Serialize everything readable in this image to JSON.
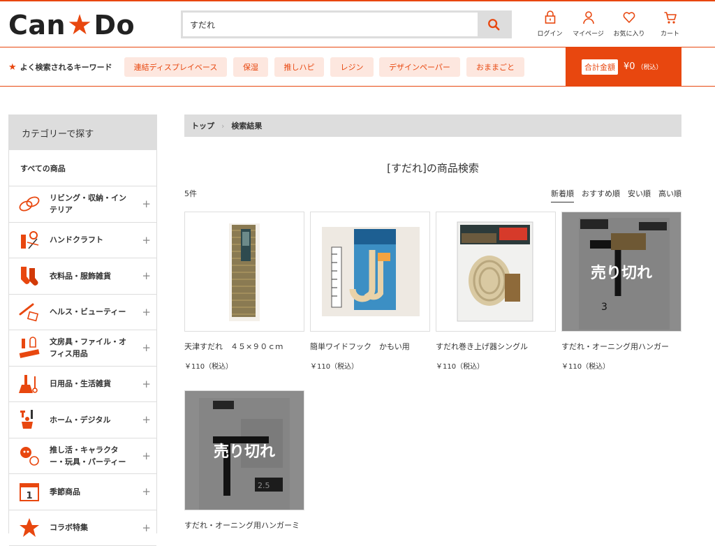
{
  "header": {
    "logo_left": "Can",
    "logo_right": "Do",
    "search_value": "すだれ",
    "icons": [
      {
        "label": "ログイン",
        "icon": "lock-icon"
      },
      {
        "label": "マイページ",
        "icon": "user-icon"
      },
      {
        "label": "お気に入り",
        "icon": "heart-icon"
      },
      {
        "label": "カート",
        "icon": "cart-icon"
      }
    ]
  },
  "keywords": {
    "title": "よく検索されるキーワード",
    "items": [
      "連結ディスプレイベース",
      "保湿",
      "推しハピ",
      "レジン",
      "デザインペーパー",
      "おままごと"
    ]
  },
  "total": {
    "label": "合計金額",
    "amount": "¥0",
    "tax": "（税込）"
  },
  "sidebar": {
    "title": "カテゴリーで探す",
    "all": "すべての商品",
    "items": [
      {
        "label": "リビング・収納・インテリア",
        "icon": "living-icon"
      },
      {
        "label": "ハンドクラフト",
        "icon": "handcraft-icon"
      },
      {
        "label": "衣料品・服飾雑貨",
        "icon": "socks-icon"
      },
      {
        "label": "ヘルス・ビューティー",
        "icon": "beauty-icon"
      },
      {
        "label": "文房具・ファイル・オフィス用品",
        "icon": "stationery-icon"
      },
      {
        "label": "日用品・生活雑貨",
        "icon": "daily-goods-icon"
      },
      {
        "label": "ホーム・デジタル",
        "icon": "tools-icon"
      },
      {
        "label": "推し活・キャラクター・玩具・パーティー",
        "icon": "party-icon"
      },
      {
        "label": "季節商品",
        "icon": "calendar-icon"
      },
      {
        "label": "コラボ特集",
        "icon": "star-icon"
      }
    ]
  },
  "breadcrumb": [
    "トップ",
    "検索結果"
  ],
  "results": {
    "title": "[すだれ]の商品検索",
    "count": "5件",
    "sorts": [
      "新着順",
      "おすすめ順",
      "安い順",
      "高い順"
    ],
    "sold_out_label": "売り切れ",
    "products": [
      {
        "name": "天津すだれ　４５×９０ｃｍ",
        "price": "￥110（税込）",
        "sold_out": false
      },
      {
        "name": "簡単ワイドフック　かもい用",
        "price": "￥110（税込）",
        "sold_out": false
      },
      {
        "name": "すだれ巻き上げ器シングル",
        "price": "￥110（税込）",
        "sold_out": false
      },
      {
        "name": "すだれ・オーニング用ハンガー",
        "price": "￥110（税込）",
        "sold_out": true
      },
      {
        "name": "すだれ・オーニング用ハンガーミ",
        "price": "",
        "sold_out": true
      }
    ]
  },
  "colors": {
    "accent": "#e8470f",
    "chip_bg": "#fde7df",
    "gray": "#dddddd"
  }
}
